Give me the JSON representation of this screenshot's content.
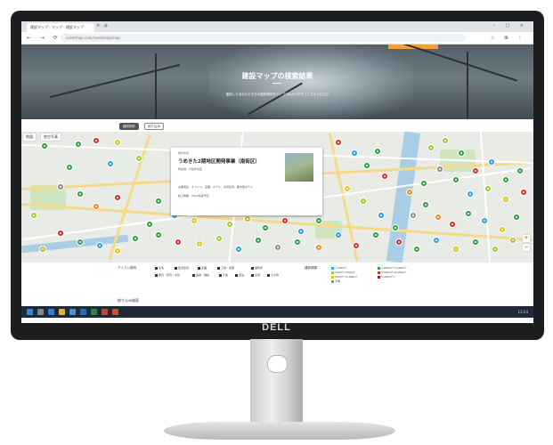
{
  "monitor": {
    "brand": "DELL"
  },
  "browser": {
    "tab_title": "建設マップ｜マップ · 建設マップ",
    "tab_close": "×",
    "new_tab": "+",
    "window_controls": "– □ ×",
    "nav_icons": "← → ⟳",
    "url": "constmap.com/constmap/map",
    "toolbar_icons": "☆ ⊕ ⋮"
  },
  "hero": {
    "title": "建設マップの検索結果",
    "subtitle": "建設したあなたのまちの建設物件をマップでわかりやすくごらんください"
  },
  "filters": {
    "chip1": "建設物件",
    "chip2": "絞り込み"
  },
  "map": {
    "map_type_a": "地図",
    "map_type_b": "航空写真",
    "zoom_in": "+",
    "zoom_out": "−",
    "popup": {
      "small": "物件情報",
      "title": "うめきた2期地区開発事業（南街区）",
      "row1": "所在地：大阪市北区",
      "row2": "主要用途　オフィス、店舗、ホテル、共同住宅、都市型ホテル",
      "row3": "竣工時期　2024年度予定"
    },
    "pin_colors": {
      "green": "#2fa043",
      "red": "#d22f2f",
      "yellow": "#e8c41c",
      "lime": "#9ccc35",
      "blue": "#2e9ee0",
      "gray": "#8b8f93",
      "orange": "#f08a24",
      "olive": "#c1b53a"
    }
  },
  "legend": {
    "icon_title": "アイコン説明",
    "icons": [
      "住宅",
      "集合住宅",
      "店舗",
      "工場・倉庫",
      "事務所",
      "教育・研究・文化",
      "医療・福祉",
      "庁舎",
      "宿泊",
      "交通",
      "その他"
    ],
    "scale_title": "建設規模",
    "scales": [
      {
        "label": "〜100m²",
        "color": "#2e9ee0"
      },
      {
        "label": "100m²〜500m²",
        "color": "#9ccc35"
      },
      {
        "label": "500m²〜1,000m²",
        "color": "#e8c41c"
      },
      {
        "label": "1,000m²〜3,000m²",
        "color": "#2fa043"
      },
      {
        "label": "3,000m²〜5,000m²",
        "color": "#d22f2f"
      },
      {
        "label": "5,000m²〜",
        "color": "#8b2020"
      },
      {
        "label": "不明",
        "color": "#8b8f93"
      }
    ]
  },
  "page": {
    "section_title": "絞り込み検索"
  },
  "taskbar": {
    "time": "13:24"
  }
}
